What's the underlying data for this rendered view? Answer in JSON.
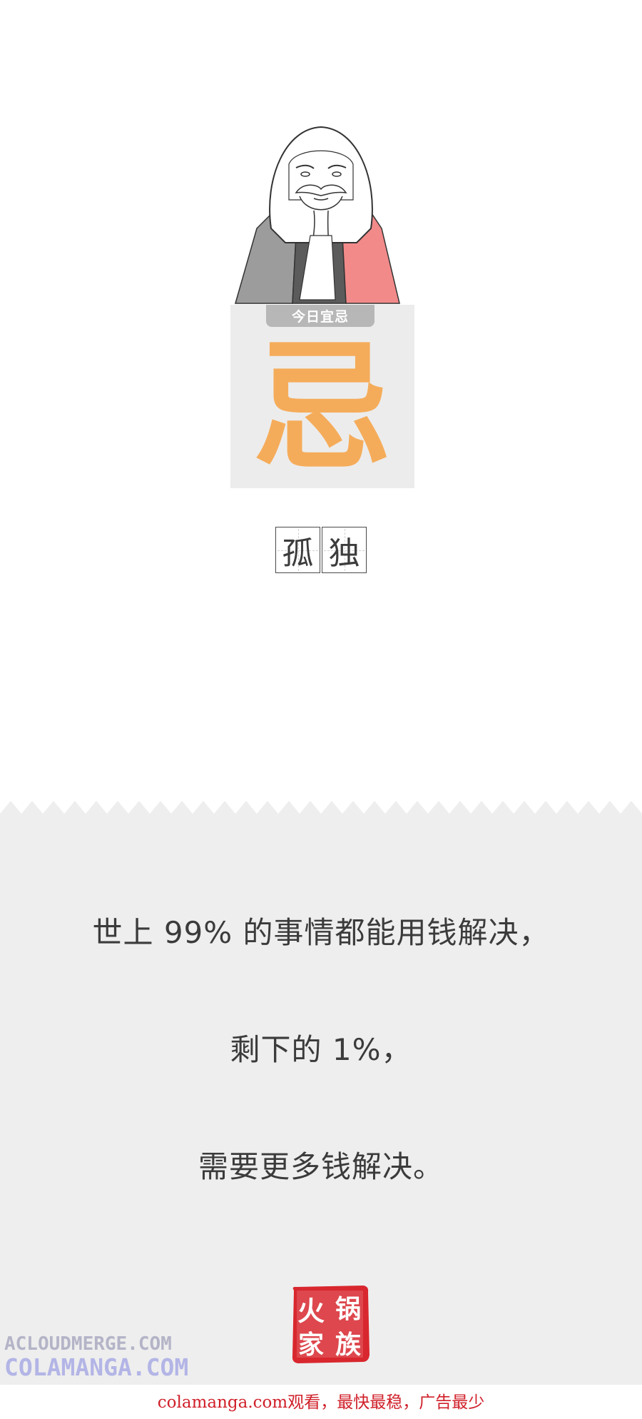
{
  "card": {
    "tag": "今日宜忌",
    "big_char": "忌"
  },
  "word": [
    "孤",
    "独"
  ],
  "quote": {
    "line1": "世上 99% 的事情都能用钱解决，",
    "line2": "剩下的 1%，",
    "line3": "需要更多钱解决。"
  },
  "seal": {
    "text": "火锅家族"
  },
  "watermarks": {
    "line1": "ACLOUDMERGE.COM",
    "line2": "COLAMANGA.COM"
  },
  "footer": "colamanga.com观看，最快最稳，广告最少",
  "colors": {
    "big_char": "#f5ac5a",
    "card_bg": "#ececec",
    "lower_bg": "#eeeeee",
    "footer_text": "#d0202a",
    "seal_red": "#d8272e"
  }
}
